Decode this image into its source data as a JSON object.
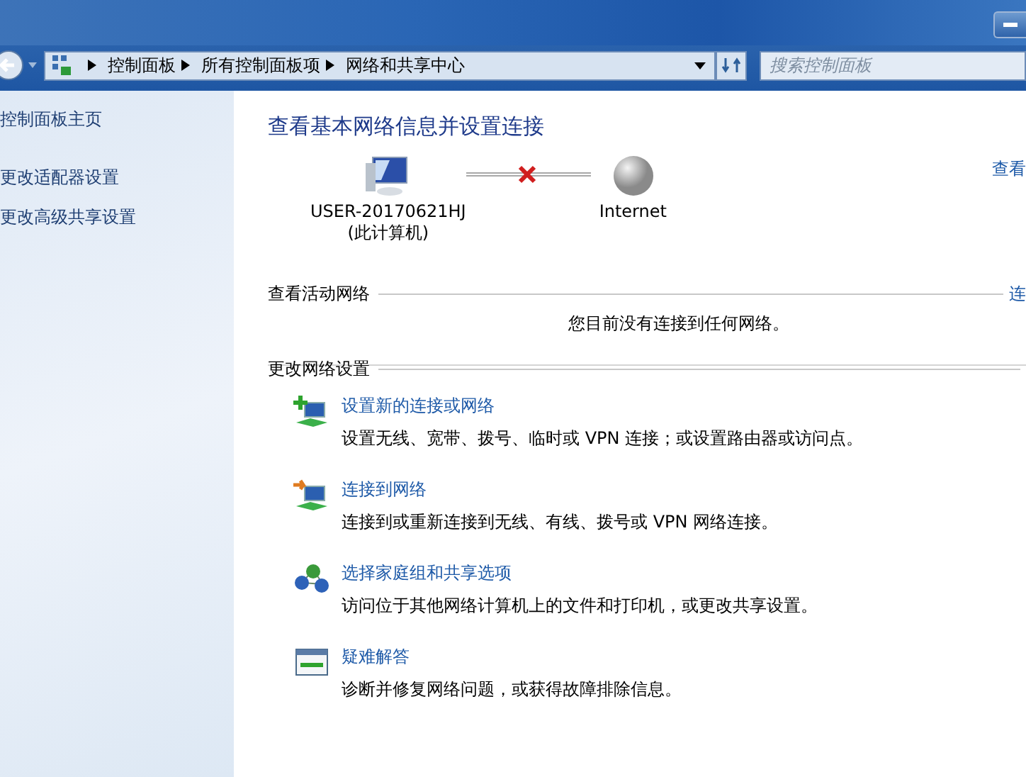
{
  "address_bar": {
    "path": [
      {
        "label": "控制面板"
      },
      {
        "label": "所有控制面板项"
      },
      {
        "label": "网络和共享中心"
      }
    ]
  },
  "search": {
    "placeholder": "搜索控制面板"
  },
  "sidebar": {
    "items": [
      {
        "label": "控制面板主页"
      },
      {
        "label": "更改适配器设置"
      },
      {
        "label": "更改高级共享设置"
      }
    ]
  },
  "title": "查看基本网络信息并设置连接",
  "map": {
    "computer": "USER-20170621HJ",
    "computer_note": "(此计算机)",
    "internet": "Internet",
    "connected": false,
    "link": "查看"
  },
  "active_networks": {
    "heading": "查看活动网络",
    "link": "连",
    "message": "您目前没有连接到任何网络。"
  },
  "settings": {
    "heading": "更改网络设置",
    "tasks": [
      {
        "kind": "new",
        "title": "设置新的连接或网络",
        "description": "设置无线、宽带、拨号、临时或 VPN 连接；或设置路由器或访问点。"
      },
      {
        "kind": "connect",
        "title": "连接到网络",
        "description": "连接到或重新连接到无线、有线、拨号或 VPN 网络连接。"
      },
      {
        "kind": "homegroup",
        "title": "选择家庭组和共享选项",
        "description": "访问位于其他网络计算机上的文件和打印机，或更改共享设置。"
      },
      {
        "kind": "troubleshoot",
        "title": "疑难解答",
        "description": "诊断并修复网络问题，或获得故障排除信息。"
      }
    ]
  }
}
